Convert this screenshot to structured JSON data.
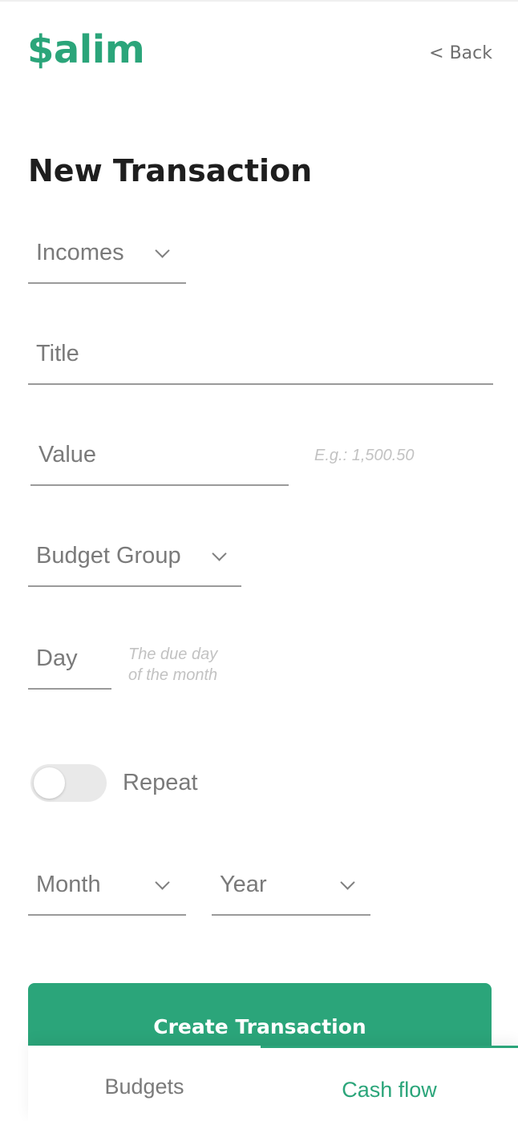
{
  "app": {
    "logo": "$alim",
    "back_label": "< Back"
  },
  "page": {
    "title": "New Transaction"
  },
  "form": {
    "type_select": {
      "label": "Incomes"
    },
    "title_field": {
      "label": "Title"
    },
    "value_field": {
      "label": "Value",
      "hint": "E.g.: 1,500.50"
    },
    "budget_group_select": {
      "label": "Budget Group"
    },
    "day_field": {
      "label": "Day",
      "hint_line1": "The due day",
      "hint_line2": "of the month"
    },
    "repeat": {
      "label": "Repeat",
      "enabled": false
    },
    "month_select": {
      "label": "Month"
    },
    "year_select": {
      "label": "Year"
    },
    "submit_label": "Create Transaction"
  },
  "bottom_nav": {
    "tabs": [
      {
        "label": "Budgets",
        "active": false
      },
      {
        "label": "Cash flow",
        "active": true
      }
    ]
  },
  "colors": {
    "accent": "#2ba57a",
    "title": "#1e1e1e",
    "field_label": "#7a7a7a",
    "hint": "#c2c2c2"
  }
}
